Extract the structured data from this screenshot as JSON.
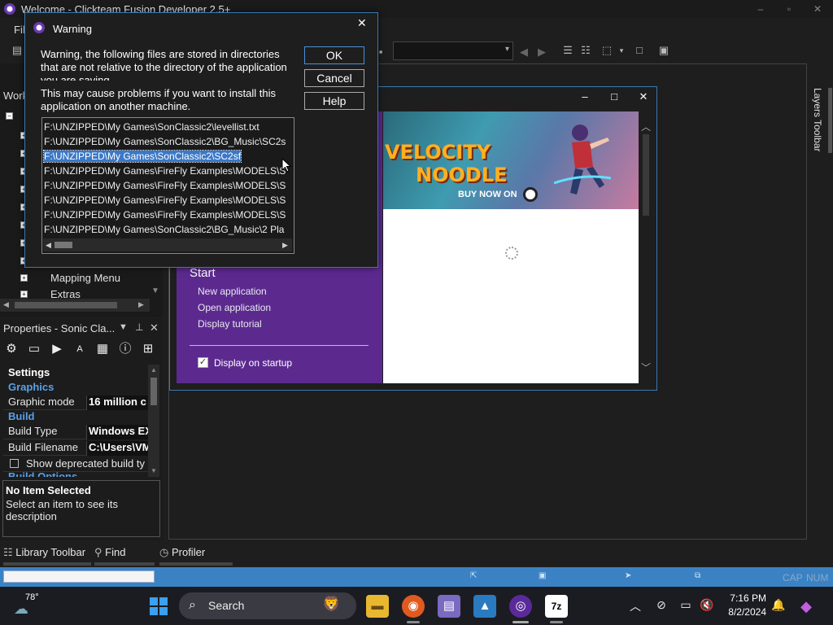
{
  "window": {
    "title": "Welcome - Clickteam Fusion Developer 2.5+",
    "minimize": "–",
    "maximize": "▫",
    "close": "✕"
  },
  "menubar": {
    "first_menu": "Fil"
  },
  "workspace": {
    "title": "Work",
    "tree_items": [
      "Mapping Menu",
      "Extras"
    ]
  },
  "properties": {
    "title": "Properties - Sonic Cla...",
    "sections": {
      "settings": "Settings",
      "graphics": "Graphics",
      "build": "Build",
      "build_options": "Build Options"
    },
    "rows": [
      {
        "name": "Graphic mode",
        "value": "16 million c"
      },
      {
        "name": "Build Type",
        "value": "Windows EX"
      },
      {
        "name": "Build Filename",
        "value": "C:\\Users\\VM"
      }
    ],
    "checkbox_label": "Show deprecated build ty",
    "description": {
      "title": "No Item Selected",
      "text": "Select an item to see its description"
    }
  },
  "bottom_tabs": [
    "Library Toolbar",
    "Find",
    "Profiler"
  ],
  "layers_toolbar": {
    "label": "Layers Toolbar"
  },
  "statusbar": {
    "caps": "CAP",
    "num": "NUM"
  },
  "welcome": {
    "start_heading": "Start",
    "links": [
      "New application",
      "Open application",
      "Display tutorial"
    ],
    "display_on_startup": "Display on startup",
    "display_on_startup_checked": true,
    "banner": {
      "line1": "VELOCITY",
      "line2": "NOODLE",
      "buy": "BUY NOW ON"
    }
  },
  "warning": {
    "title": "Warning",
    "message_part1": "Warning, the following files are stored in directories that are not relative to the directory of the application you are saving.",
    "message_part2": "This may cause problems if you want to install this application on another machine.",
    "buttons": {
      "ok": "OK",
      "cancel": "Cancel",
      "help": "Help"
    },
    "files": [
      "F:\\UNZIPPED\\My Games\\SonClassic2\\levellist.txt",
      "F:\\UNZIPPED\\My Games\\SonClassic2\\BG_Music\\SC2s",
      "F:\\UNZIPPED\\My Games\\SonClassic2\\SC2sf",
      "F:\\UNZIPPED\\My Games\\FireFly Examples\\MODELS\\S",
      "F:\\UNZIPPED\\My Games\\FireFly Examples\\MODELS\\S",
      "F:\\UNZIPPED\\My Games\\FireFly Examples\\MODELS\\S",
      "F:\\UNZIPPED\\My Games\\FireFly Examples\\MODELS\\S",
      "F:\\UNZIPPED\\My Games\\SonClassic2\\BG_Music\\2 Pla"
    ],
    "selected_index": 2
  },
  "taskbar": {
    "weather": "78°",
    "search_placeholder": "Search",
    "time": "7:16 PM",
    "date": "8/2/2024"
  }
}
